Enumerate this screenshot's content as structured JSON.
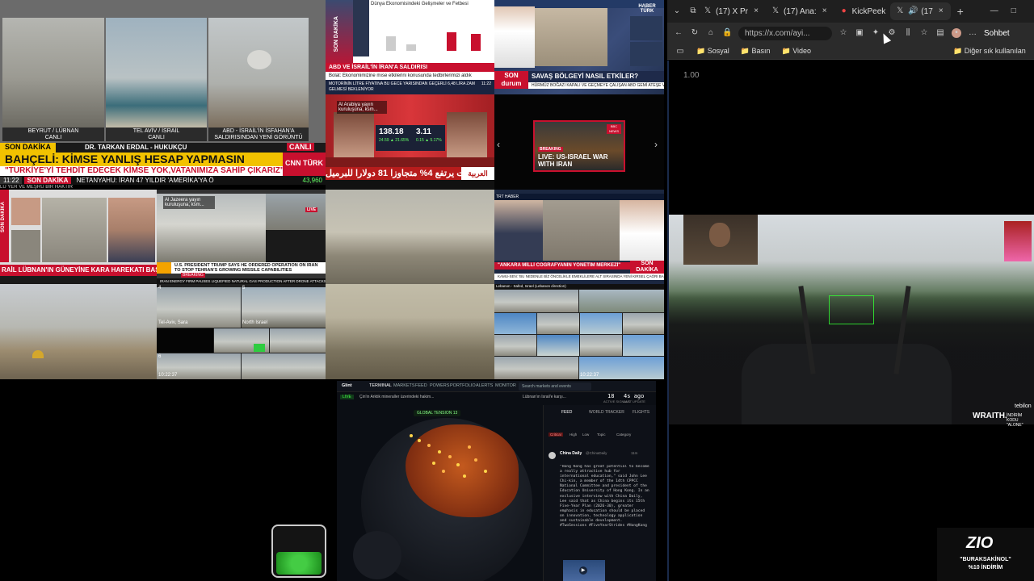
{
  "tiles": {
    "t1": {
      "labels": [
        "BEYRUT / LÜBNAN",
        "CANLI",
        "TEL AVİV / İSRAİL",
        "CANLI",
        "ABD - İSRAİL'İN İSFAHAN'A",
        "SALDIRISINDAN YENİ GÖRÜNTÜ"
      ],
      "son_dakika": "SON DAKİKA",
      "guest": "DR. TARKAN ERDAL - HUKUKÇU",
      "canli": "CANLI",
      "headline": "BAHÇELİ: KİMSE YANLIŞ HESAP YAPMASIN",
      "subline": "\"TÜRKİYE'Yİ TEHDİT EDECEK KİMSE YOK,VATANIMIZA SAHİP ÇIKARIZ\"",
      "ticker_time": "11:22",
      "ticker_tag": "SON DAKİKA",
      "ticker_text": "NETANYAHU: İRAN 47 YILDIR 'AMERİKA'YA Ö",
      "index": "43,960",
      "brand": "CNN TÜRK",
      "bottom_text": "LÜ YER VE MEŞRU BİR HAKTIR"
    },
    "t2": {
      "top": "Dünya Ekonomisindeki Gelişmeler ve Fetbesi",
      "side": "SON DAKİKA",
      "band": "ABD VE İSRAİL'İN İRAN'A SALDIRISI",
      "sub": "Bolat: Ekonomimizine mıse etkilerini konusunda tedbirlerimizi aldık",
      "ticker": "MOTORİNİN LİTRE FİYATINA BU GECE YARISINDAN GEÇERLİ 6,48 LİRA ZAM GELMESİ BEKLENİYOR",
      "time": "11:22"
    },
    "t3": {
      "band": "SAVAŞ BÖLGEYİ NASIL ETKİLER?",
      "side": "SON durum",
      "brand": "HABER TÜRK",
      "ticker": "HÜRMÜZ BOĞAZI KAPALI VE GEÇMEYE ÇALIŞAN ABD GEMİ ATEŞE VERİLECEK"
    },
    "t4": {
      "tag": "Al Arabiya yayın kuruluşuna, ksm...",
      "val1": "138.18",
      "val1b": "24.59 ▲ 21.65%",
      "val2": "3.11",
      "val2b": "0.15 ▲ 5.17%",
      "band": "خام برنت يرتفع 4% متجاوزا 81 دولارا للبرميل",
      "brand": "العربية"
    },
    "t5": {
      "breaking": "BREAKING",
      "title": "LIVE: US-ISRAEL WAR WITH IRAN",
      "brand": "BBC NEWS",
      "prev": "‹",
      "next": "›"
    },
    "t6": {
      "side": "SON DAKİKA",
      "band": "RAİL LÜBNAN'IN GÜNEYİNE KARA HAREKATI BAŞLATTI"
    },
    "t7": {
      "tag": "Al Jazeera yayın kuruluşuna, ksm...",
      "live": "LIVE",
      "band": "U.S. PRESIDENT TRUMP SAYS HE ORDERED OPERATION ON IRAN TO STOP TEHRAN'S GROWING MISSILE CAPABILITIES",
      "breaking": "BREAKING",
      "ticker": "IRAN ENERGY FIRM PAUSES LIQUEFIED NATURAL GAS PRODUCTION AFTER DRONE ATTACKS ON FACIL"
    },
    "t8": {
      "band": "\"ANKARA MİLLİ COĞRAFYANIN YÖNETİM MERKEZİ\"",
      "side": "SON DAKİKA",
      "brand": "TRT HABER",
      "ticker": "KAMU-SEN: 'BU NEDENLE BİZ ÖNCELİKLE EMEKLİLERE ALT SIRASINDA YENİ KIRSEL ÇAĞRI BAŞLATIYORUZ"
    },
    "t9": {
      "grid_labels": [
        "Tel-Aviv, Sara",
        "North Israel"
      ],
      "nums": [
        "4",
        "5",
        "6"
      ],
      "time": "10:22:37"
    },
    "t10": {
      "cam": "Lebanon - Safed, Israel (Lebanon direction)",
      "time": "10:22:37"
    }
  },
  "dashboard": {
    "logo": "Glint",
    "menu": [
      "TERMINAL",
      "MARKETS",
      "FEED",
      "POWERS",
      "PORTFOLIO",
      "ALERTS",
      "MONITOR"
    ],
    "search": "Search markets and events",
    "live": "LIVE",
    "ticker": "Çin'in Arktik mineraller üzerindeki hakim...",
    "ticker2": "Lübnan'ın İsrail'e karşı...",
    "tension": "GLOBAL TENSION",
    "tension_val": "13",
    "counter": "18",
    "counter_label": "ACTIVE SIGNALS",
    "ago": "4s ago",
    "ago_label": "LAST UPDATE",
    "feed_tabs": [
      "FEED",
      "WORLD TRACKER",
      "FLIGHTS"
    ],
    "filters": [
      "Critical",
      "High",
      "Low",
      "Topic",
      "Category"
    ],
    "post_author": "China Daily",
    "post_handle": "@ChinaDaily",
    "post_time": "11m",
    "post_body": "\"Hong Kong has great potential to become a really attractive hub for international education,\" said John Lee Chi-kin, a member of the 14th CPPCC National Committee and president of the Education University of Hong Kong. In an exclusive interview with China Daily, Lee said that as China begins its 15th Five-Year Plan (2026-30), greater emphasis in education should be placed on innovation, technology application and sustainable development. #TwoSessions #FiveYearStrides #HongKong"
  },
  "browser": {
    "tabs": [
      {
        "label": "(17) X Pr",
        "icon": "x-icon"
      },
      {
        "label": "(17) Ana:",
        "icon": "x-icon"
      },
      {
        "label": "KickPeek",
        "icon": "kick-icon"
      },
      {
        "label": "(17",
        "icon": "x-icon"
      }
    ],
    "new_tab": "+",
    "url": "https://x.com/ayi...",
    "profile": "Sohbet",
    "favorites": [
      "Sosyal",
      "Basın",
      "Video"
    ],
    "other_favs": "Diğer sık kullanılan",
    "zoom": "1.00"
  },
  "game": {
    "watermark": "WRAITH.",
    "sub": "İNDİRİM KODU \"ALONE\"",
    "partial": "tebilon"
  },
  "promo": {
    "brand": "ZIO",
    "line1": "\"BURAKSAKİNOL\"",
    "line2": "%10 İNDİRİM"
  },
  "colors": {
    "accent_red": "#c8102e",
    "cnn_yellow": "#f2c200",
    "browser_bg": "#1f1f1f",
    "dashboard_orange": "#d2561a"
  }
}
